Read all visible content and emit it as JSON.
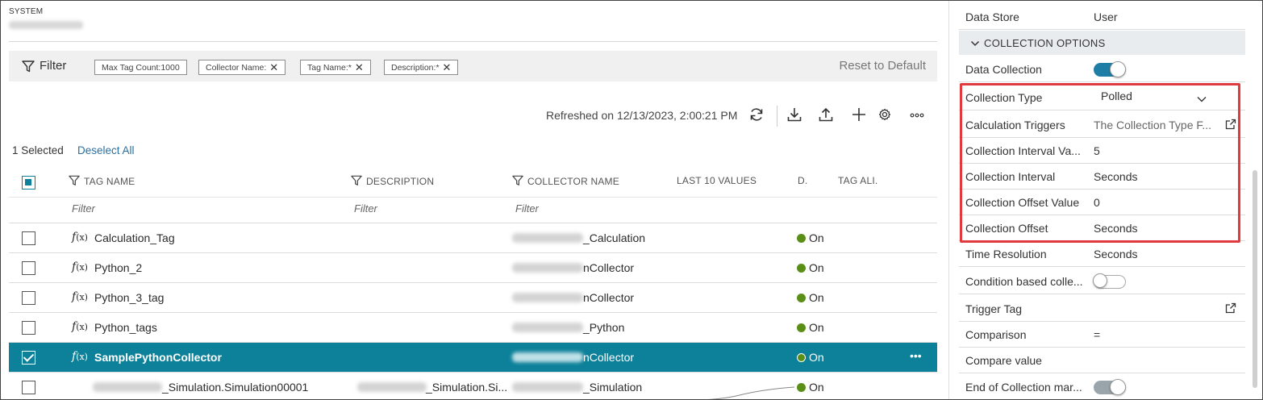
{
  "header": {
    "system_label": "SYSTEM"
  },
  "filter_bar": {
    "label": "Filter",
    "chips": [
      {
        "label": "Max Tag Count:1000",
        "removable": false
      },
      {
        "label": "Collector Name:",
        "removable": true
      },
      {
        "label": "Tag Name:*",
        "removable": true
      },
      {
        "label": "Description:*",
        "removable": true
      }
    ],
    "reset_label": "Reset to Default",
    "remove_glyph": "✕"
  },
  "toolbar": {
    "refreshed_text": "Refreshed on 12/13/2023, 2:00:21 PM",
    "icons": [
      "refresh-icon",
      "download-icon",
      "upload-icon",
      "add-icon",
      "settings-icon",
      "more-icon"
    ]
  },
  "selection": {
    "count_text": "1 Selected",
    "deselect_label": "Deselect All"
  },
  "table": {
    "columns": {
      "tag_name": "TAG NAME",
      "description": "DESCRIPTION",
      "collector_name": "COLLECTOR NAME",
      "last_values": "LAST 10 VALUES",
      "d": "D.",
      "tag_alias": "TAG ALI."
    },
    "filter_placeholder": "Filter",
    "fx_symbol": "f",
    "fx_suffix": "(x)",
    "rows": [
      {
        "name": "Calculation_Tag",
        "collector_suffix": "_Calculation",
        "description": "",
        "status": "On",
        "checked": false,
        "selected": false,
        "fx": true
      },
      {
        "name": "Python_2",
        "collector_suffix": "nCollector",
        "description": "",
        "status": "On",
        "checked": false,
        "selected": false,
        "fx": true
      },
      {
        "name": "Python_3_tag",
        "collector_suffix": "nCollector",
        "description": "",
        "status": "On",
        "checked": false,
        "selected": false,
        "fx": true
      },
      {
        "name": "Python_tags",
        "collector_suffix": "_Python",
        "description": "",
        "status": "On",
        "checked": false,
        "selected": false,
        "fx": true
      },
      {
        "name": "SamplePythonCollector",
        "collector_suffix": "nCollector",
        "description": "",
        "status": "On",
        "checked": true,
        "selected": true,
        "fx": true,
        "more": "•••"
      },
      {
        "name": "_Simulation.Simulation00001",
        "collector_suffix": "_Simulation",
        "description": "_Simulation.Si...",
        "status": "On",
        "checked": false,
        "selected": false,
        "fx": false
      }
    ]
  },
  "details": {
    "data_store": {
      "label": "Data Store",
      "value": "User"
    },
    "section_title": "COLLECTION OPTIONS",
    "data_collection": {
      "label": "Data Collection",
      "enabled": true
    },
    "collection_type": {
      "label": "Collection Type",
      "value": "Polled"
    },
    "calculation_triggers": {
      "label": "Calculation Triggers",
      "value": "The Collection Type F..."
    },
    "collection_interval_value": {
      "label": "Collection Interval Va...",
      "value": "5"
    },
    "collection_interval": {
      "label": "Collection Interval",
      "value": "Seconds"
    },
    "collection_offset_value": {
      "label": "Collection Offset Value",
      "value": "0"
    },
    "collection_offset": {
      "label": "Collection Offset",
      "value": "Seconds"
    },
    "time_resolution": {
      "label": "Time Resolution",
      "value": "Seconds"
    },
    "condition_based": {
      "label": "Condition based colle...",
      "enabled": false
    },
    "trigger_tag": {
      "label": "Trigger Tag",
      "value": ""
    },
    "comparison": {
      "label": "Comparison",
      "value": "="
    },
    "compare_value": {
      "label": "Compare value",
      "value": ""
    },
    "end_of_collection": {
      "label": "End of Collection mar...",
      "enabled": true,
      "disabled": true
    }
  },
  "colors": {
    "accent": "#0d8199",
    "highlight_box": "#e0393e",
    "status_on": "#5a8f16",
    "toggle_on": "#1f7ea6"
  }
}
